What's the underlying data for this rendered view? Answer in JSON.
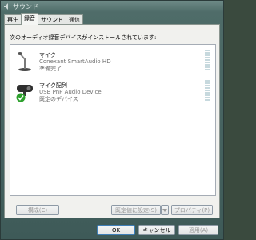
{
  "window": {
    "title": "サウンド"
  },
  "tabs": [
    {
      "label": "再生",
      "active": false
    },
    {
      "label": "録音",
      "active": true
    },
    {
      "label": "サウンド",
      "active": false
    },
    {
      "label": "通信",
      "active": false
    }
  ],
  "recording": {
    "instructions": "次のオーディオ録音デバイスがインストールされています:",
    "devices": [
      {
        "name": "マイク",
        "description": "Conexant SmartAudio HD",
        "status": "準備完了",
        "icon": "microphone-icon",
        "is_default": false
      },
      {
        "name": "マイク配列",
        "description": "USB PnP Audio Device",
        "status": "既定のデバイス",
        "icon": "webcam-microphone-icon",
        "is_default": true
      }
    ]
  },
  "panel_buttons": {
    "configure": "構成(C)",
    "set_default": "既定値に設定(S)",
    "properties": "プロパティ(P)"
  },
  "dialog_buttons": {
    "ok": "OK",
    "cancel": "キャンセル",
    "apply": "適用(A)"
  },
  "colors": {
    "accent": "#3f7fb8",
    "default_check": "#2ca02c",
    "level_meter": "#c7d9de"
  }
}
